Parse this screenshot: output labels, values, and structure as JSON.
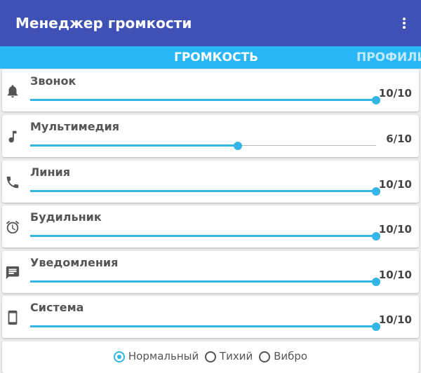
{
  "app": {
    "title": "Менеджер громкости",
    "menu_icon": "overflow-menu-icon"
  },
  "colors": {
    "appbar": "#3f51b5",
    "tabbar": "#29b6f6",
    "accent": "#33b5e5"
  },
  "tabs": [
    {
      "label": "ГРОМКОСТЬ",
      "selected": true
    },
    {
      "label": "ПРОФИЛИ",
      "selected": false
    }
  ],
  "volumes": [
    {
      "label": "Звонок",
      "icon": "bell-icon",
      "level": 10,
      "max": 10,
      "value_text": "10/10"
    },
    {
      "label": "Мультимедия",
      "icon": "music-note-icon",
      "level": 6,
      "max": 10,
      "value_text": "6/10"
    },
    {
      "label": "Линия",
      "icon": "phone-icon",
      "level": 10,
      "max": 10,
      "value_text": "10/10"
    },
    {
      "label": "Будильник",
      "icon": "alarm-clock-icon",
      "level": 10,
      "max": 10,
      "value_text": "10/10"
    },
    {
      "label": "Уведомления",
      "icon": "message-icon",
      "level": 10,
      "max": 10,
      "value_text": "10/10"
    },
    {
      "label": "Система",
      "icon": "smartphone-icon",
      "level": 10,
      "max": 10,
      "value_text": "10/10"
    }
  ],
  "modes": {
    "options": [
      "Нормальный",
      "Тихий",
      "Вибро"
    ],
    "selected": "Нормальный"
  }
}
